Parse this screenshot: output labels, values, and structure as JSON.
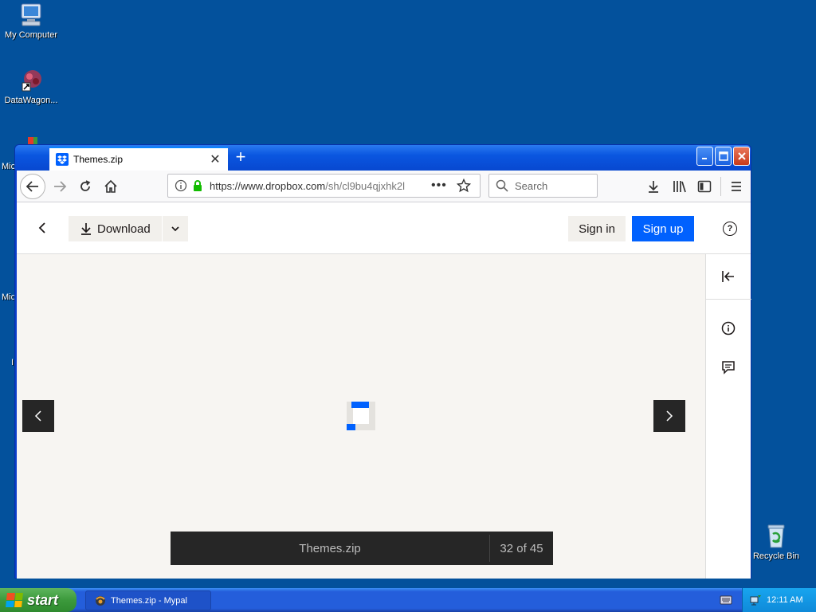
{
  "desktop": {
    "icons": {
      "my_computer": "My Computer",
      "datawagon": "DataWagon...",
      "recycle_bin": "Recycle Bin"
    },
    "partial_labels": [
      "Mic",
      "Mic",
      "I"
    ]
  },
  "browser": {
    "tab_title": "Themes.zip",
    "new_tab_label": "+",
    "url_host": "https://www.dropbox.com",
    "url_path": "/sh/cl9bu4qjxhk2l",
    "search_placeholder": "Search"
  },
  "page": {
    "download_label": "Download",
    "signin_label": "Sign in",
    "signup_label": "Sign up",
    "help_label": "?",
    "file_name": "Themes.zip",
    "position": "32 of 45"
  },
  "taskbar": {
    "start_label": "start",
    "task_label": "Themes.zip - Mypal",
    "clock": "12:11 AM"
  },
  "colors": {
    "desktop": "#03519c",
    "accent": "#0061fe",
    "preview_bg": "#f7f5f2"
  }
}
